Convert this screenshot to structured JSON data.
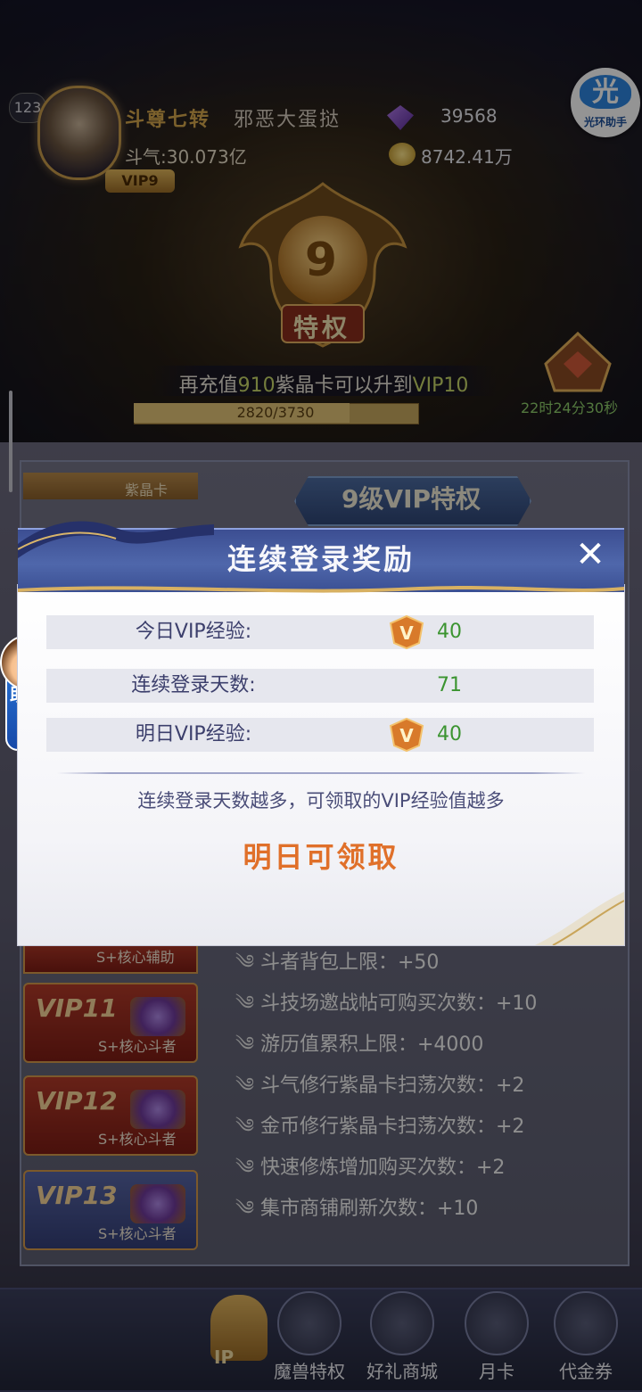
{
  "player": {
    "level": "123",
    "title": "斗尊七转",
    "name": "邪恶大蛋挞",
    "vip_tag": "VIP9",
    "power": "斗气:30.073亿",
    "crystals": "39568",
    "gold": "8742.41万"
  },
  "emblem": {
    "number": "9",
    "label": "特权"
  },
  "recharge": {
    "prefix": "再充值",
    "amount": "910",
    "middle": "紫晶卡可以升到",
    "target": "VIP10",
    "progress_text": "2820/3730",
    "progress_fraction": 0.756
  },
  "timer": "22时24分30秒",
  "assistant_top": {
    "glyph": "光",
    "label": "光环助手"
  },
  "assistant_left": {
    "label": "助手",
    "arrow": "›"
  },
  "panel": {
    "header": "9级VIP特权",
    "purple_card_label": "紫晶卡",
    "partial_tab_sub": "S+核心辅助",
    "tabs": [
      {
        "title": "VIP11",
        "sub": "S+核心斗者",
        "style": "red"
      },
      {
        "title": "VIP12",
        "sub": "S+核心斗者",
        "style": "red"
      },
      {
        "title": "VIP13",
        "sub": "S+核心斗者",
        "style": "blue"
      }
    ],
    "perks": [
      "斗者背包上限：+50",
      "斗技场邀战帖可购买次数：+10",
      "游历值累积上限：+4000",
      "斗气修行紫晶卡扫荡次数：+2",
      "金币修行紫晶卡扫荡次数：+2",
      "快速修炼增加购买次数：+2",
      "集市商铺刷新次数：+10"
    ]
  },
  "bottom_nav": {
    "vip_label": "IP",
    "items": [
      "魔兽特权",
      "好礼商城",
      "月卡",
      "代金券"
    ]
  },
  "modal": {
    "title": "连续登录奖励",
    "close_glyph": "✕",
    "rows": [
      {
        "label": "今日VIP经验:",
        "value": "40",
        "badge": "V"
      },
      {
        "label": "连续登录天数:",
        "value": "71"
      },
      {
        "label": "明日VIP经验:",
        "value": "40",
        "badge": "V"
      }
    ],
    "hint": "连续登录天数越多，可领取的VIP经验值越多",
    "claim_status": "明日可领取"
  },
  "colors": {
    "modal_header": "#4f67ab",
    "value_green": "#3b9430",
    "claim_orange": "#e0702a",
    "label_navy": "#3c3f6c"
  }
}
